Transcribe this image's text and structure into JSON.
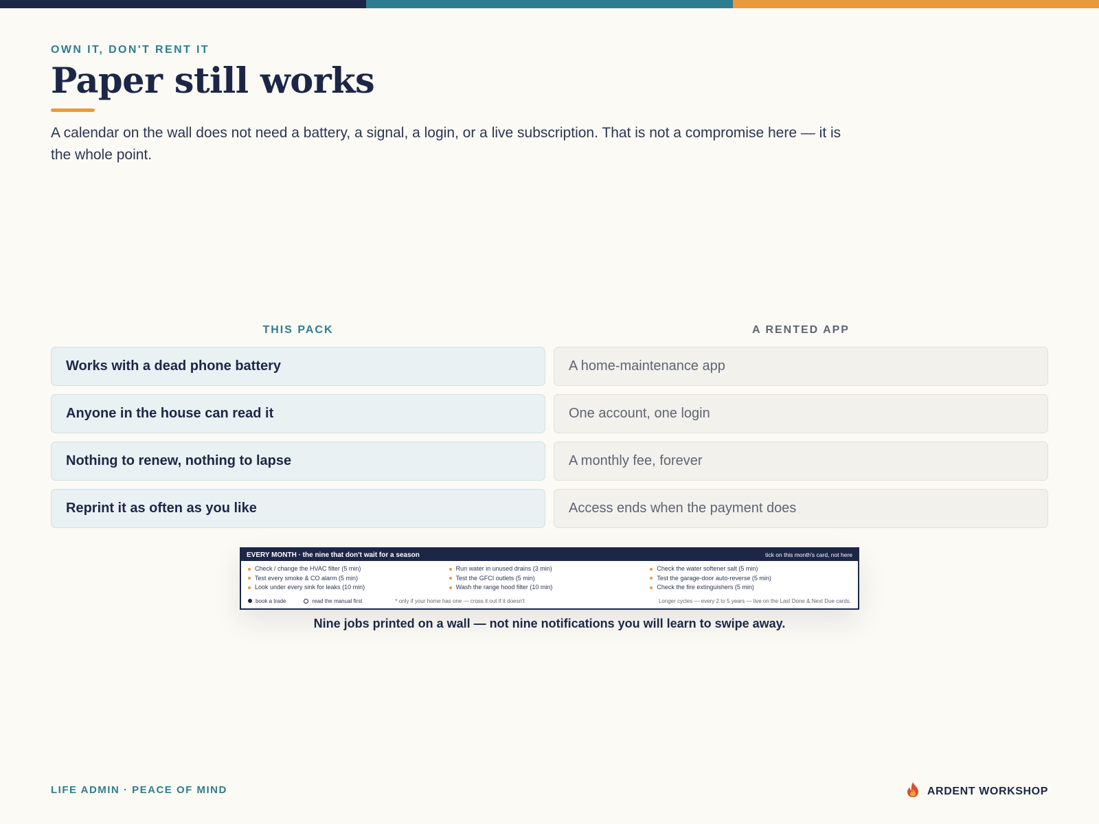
{
  "colors": {
    "navy": "#1c2747",
    "teal": "#2e7d8f",
    "orange": "#e89a3c",
    "background": "#fbfaf5"
  },
  "header": {
    "eyebrow": "OWN IT, DON'T RENT IT",
    "title": "Paper still works",
    "lede": "A calendar on the wall does not need a battery, a signal, a login, or a live subscription. That is not a compromise here — it is the whole point."
  },
  "comparison": {
    "pack_heading": "THIS PACK",
    "app_heading": "A RENTED APP",
    "pack": [
      "Works with a dead phone battery",
      "Anyone in the house can read it",
      "Nothing to renew, nothing to lapse",
      "Reprint it as often as you like"
    ],
    "app": [
      "A home-maintenance app",
      "One account, one login",
      "A monthly fee, forever",
      "Access ends when the payment does"
    ]
  },
  "card": {
    "title": "EVERY MONTH · the nine that don't wait for a season",
    "note": "tick on this month's card, not here",
    "columns": [
      [
        "Check / change the HVAC filter  (5 min)",
        "Test every smoke & CO alarm  (5 min)",
        "Look under every sink for leaks  (10 min)"
      ],
      [
        "Run water in unused drains  (3 min)",
        "Test the GFCI outlets  (5 min)",
        "Wash the range hood filter  (10 min)"
      ],
      [
        "Check the water softener salt  (5 min)",
        "Test the garage-door auto-reverse  (5 min)",
        "Check the fire extinguishers  (5 min)"
      ]
    ],
    "legend_book": "book a trade",
    "legend_manual": "read the manual first",
    "footnote": "* only if your home has one — cross it out if it doesn't",
    "longer": "Longer cycles — every 2 to 5 years — live on the Last Done & Next Due cards."
  },
  "caption": "Nine jobs printed on a wall — not nine notifications you will learn to swipe away.",
  "footer": {
    "left": "LIFE ADMIN · PEACE OF MIND",
    "brand": "ARDENT WORKSHOP",
    "brand_icon": "flame-icon"
  }
}
